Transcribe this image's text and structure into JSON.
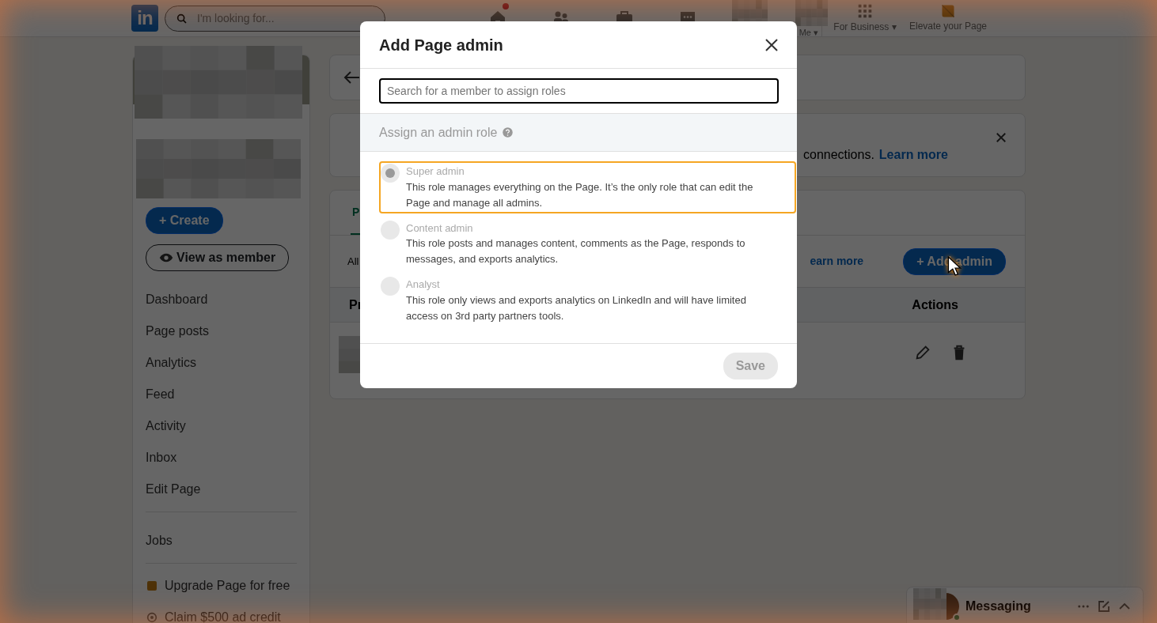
{
  "nav": {
    "logo": "in",
    "search_placeholder": "I'm looking for...",
    "items": [
      {
        "kind": "home",
        "notification": true
      },
      {
        "kind": "network",
        "notification": false
      },
      {
        "kind": "jobs",
        "notification": false
      },
      {
        "kind": "messaging",
        "notification": false
      }
    ],
    "me_label": "Me ▾",
    "for_business": "For Business ▾",
    "elevate": "Elevate your Page"
  },
  "sidebar": {
    "create": "+ Create",
    "view_as_member": "View as member",
    "groups": [
      [
        "Dashboard",
        "Page posts",
        "Analytics",
        "Feed",
        "Activity",
        "Inbox",
        "Edit Page"
      ],
      [
        "Jobs"
      ]
    ],
    "extras": [
      {
        "kind": "upgrade",
        "label": "Upgrade Page for free"
      },
      {
        "kind": "credit",
        "label": "Claim $500 ad credit"
      }
    ]
  },
  "main": {
    "notice": {
      "text": "connections.",
      "link": "Learn more"
    },
    "tabs": [
      {
        "label": "P",
        "selected": true
      }
    ],
    "filter_label": "All",
    "link": "earn more",
    "add_button": "+ Add admin",
    "table": {
      "columns": [
        "Pr",
        "Actions"
      ]
    }
  },
  "modal": {
    "title": "Add Page admin",
    "search_placeholder": "Search for a member to assign roles",
    "section": "Assign an admin role",
    "roles": [
      {
        "name": "Super admin",
        "description": "This role manages everything on the Page. It’s the only role that can edit the Page and manage all admins.",
        "selected": true,
        "focused": true
      },
      {
        "name": "Content admin",
        "description": "This role posts and manages content, comments as the Page, responds to messages, and exports analytics.",
        "selected": false,
        "focused": false
      },
      {
        "name": "Analyst",
        "description": "This role only views and exports analytics on LinkedIn and will have limited access on 3rd party partners tools.",
        "selected": false,
        "focused": false
      }
    ],
    "save": {
      "label": "Save",
      "disabled": true
    }
  },
  "messaging": {
    "label": "Messaging",
    "online": true
  }
}
